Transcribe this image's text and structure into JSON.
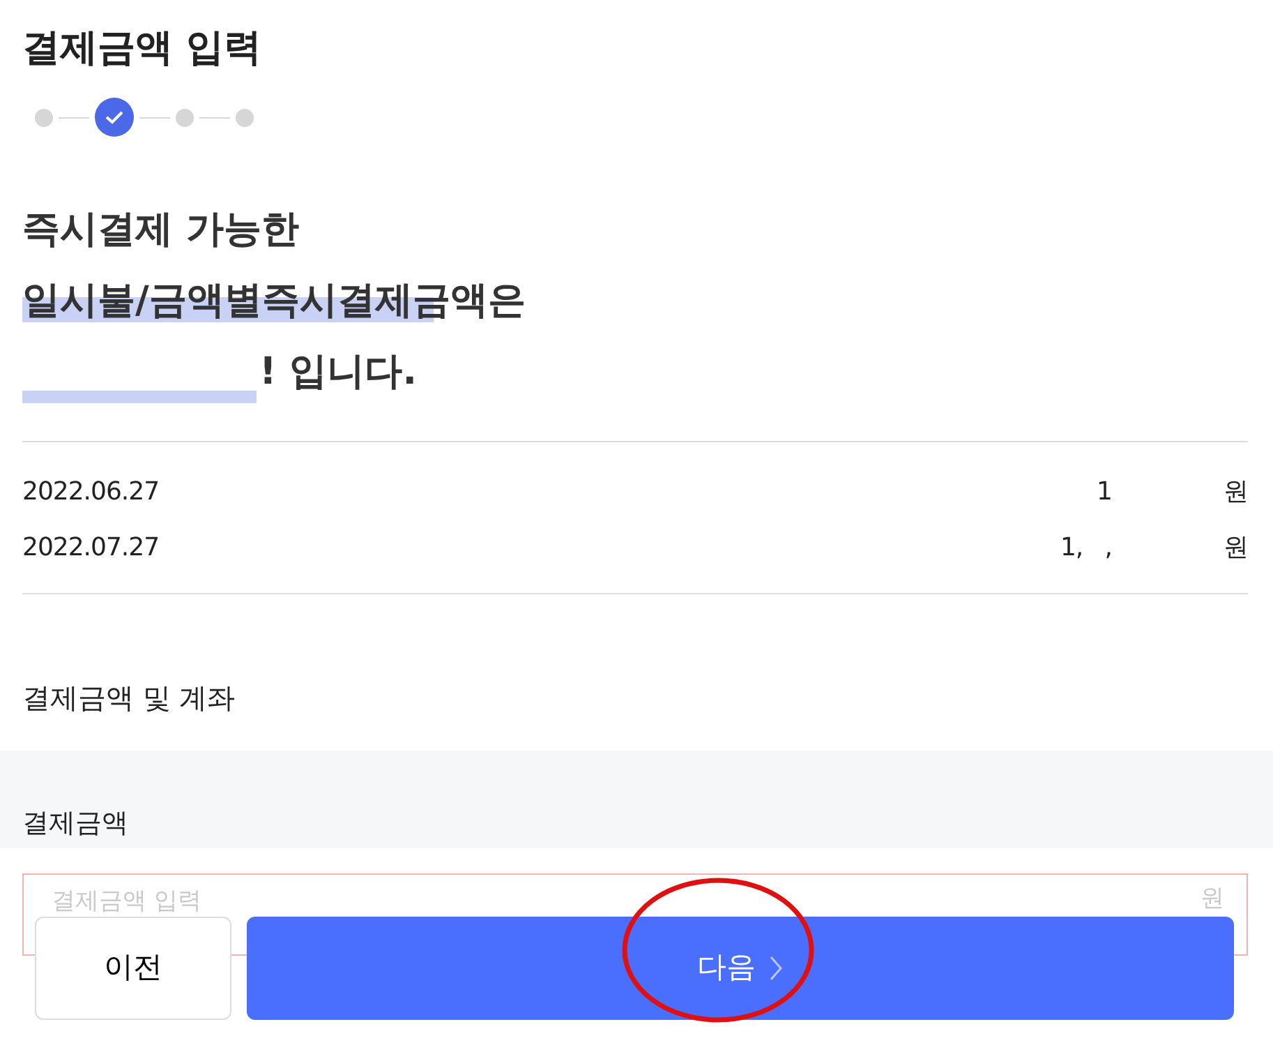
{
  "page_title": "결제금액 입력",
  "steps": [
    {
      "selected": false
    },
    {
      "selected": true
    },
    {
      "selected": false
    },
    {
      "selected": false
    }
  ],
  "headline": [
    "즉시결제 가능한",
    "일시불/금액별즉시결제금액은",
    "! 입니다."
  ],
  "schedule": [
    {
      "date": "2022.06.27",
      "amount": "1",
      "unit": "원"
    },
    {
      "date": "2022.07.27",
      "amount": "1,   ,",
      "unit": "원"
    }
  ],
  "section_title": "결제금액 및 계좌",
  "amount_field": {
    "label": "결제금액",
    "placeholder": "결제금액 입력",
    "unit": "원",
    "error": true
  },
  "buttons": {
    "prev": "이전",
    "next": "다음"
  }
}
